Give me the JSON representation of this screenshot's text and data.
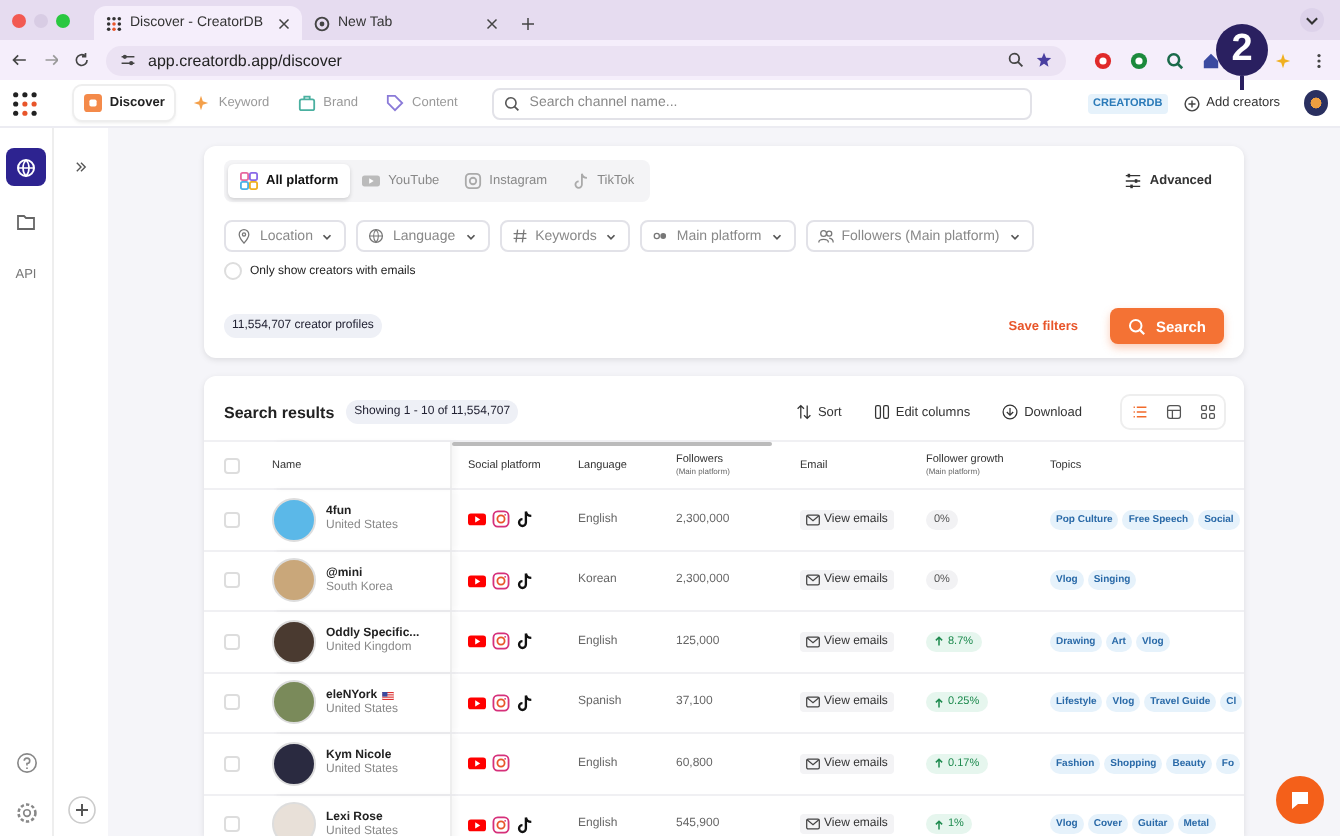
{
  "browser": {
    "tabs": [
      {
        "title": "Discover - CreatorDB",
        "selected": true
      },
      {
        "title": "New Tab",
        "selected": false
      }
    ],
    "url": "app.creatordb.app/discover",
    "annotation": "2"
  },
  "header": {
    "nav": [
      {
        "label": "Discover",
        "selected": true,
        "kind": "discover"
      },
      {
        "label": "Keyword",
        "selected": false,
        "kind": "keyword"
      },
      {
        "label": "Brand",
        "selected": false,
        "kind": "brand"
      },
      {
        "label": "Content",
        "selected": false,
        "kind": "content"
      }
    ],
    "search": {
      "placeholder": "Search channel name..."
    },
    "brand_badge": "CREATORDB",
    "add_button": "Add creators"
  },
  "rail": {
    "items": [
      {
        "kind": "globe",
        "selected": true
      },
      {
        "kind": "folder",
        "selected": false
      },
      {
        "kind": "text",
        "label": "API",
        "selected": false
      }
    ]
  },
  "filters": {
    "platforms": [
      {
        "label": "All platform",
        "selected": true,
        "kind": "all"
      },
      {
        "label": "YouTube",
        "selected": false,
        "kind": "youtube"
      },
      {
        "label": "Instagram",
        "selected": false,
        "kind": "instagram"
      },
      {
        "label": "TikTok",
        "selected": false,
        "kind": "tiktok"
      }
    ],
    "advanced": "Advanced",
    "dropdowns": [
      {
        "label": "Location",
        "kind": "pin"
      },
      {
        "label": "Language",
        "kind": "globe"
      },
      {
        "label": "Keywords",
        "kind": "hash"
      },
      {
        "label": "Main platform",
        "kind": "dots"
      },
      {
        "label": "Followers (Main platform)",
        "kind": "people"
      }
    ],
    "email_only": {
      "label": "Only show creators with emails",
      "checked": false
    },
    "count": "11,554,707 creator profiles",
    "save": "Save filters",
    "search": "Search"
  },
  "results": {
    "title": "Search results",
    "showing": "Showing 1 - 10 of 11,554,707",
    "actions": [
      {
        "label": "Sort",
        "kind": "sort"
      },
      {
        "label": "Edit columns",
        "kind": "columns"
      },
      {
        "label": "Download",
        "kind": "download"
      }
    ],
    "views": [
      {
        "kind": "list",
        "selected": true
      },
      {
        "kind": "table",
        "selected": false
      },
      {
        "kind": "grid",
        "selected": false
      }
    ],
    "select_all": {
      "checked": false
    },
    "columns": [
      {
        "label": "Name"
      },
      {
        "label": "Social platform"
      },
      {
        "label": "Language"
      },
      {
        "label": "Followers",
        "sub": "(Main platform)"
      },
      {
        "label": "Email"
      },
      {
        "label": "Follower growth",
        "sub": "(Main platform)"
      },
      {
        "label": "Topics"
      }
    ],
    "rows": [
      {
        "checked": false,
        "name": "4fun",
        "country": "United States",
        "platforms": [
          {
            "kind": "youtube"
          },
          {
            "kind": "instagram"
          },
          {
            "kind": "tiktok"
          }
        ],
        "language": "English",
        "followers": "2,300,000",
        "email": "View emails",
        "growth": {
          "text": "0%",
          "kind": "flat"
        },
        "topics": [
          "Pop Culture",
          "Free Speech",
          "Social"
        ]
      },
      {
        "checked": false,
        "name": "@mini",
        "country": "South Korea",
        "platforms": [
          {
            "kind": "youtube"
          },
          {
            "kind": "instagram"
          },
          {
            "kind": "tiktok"
          }
        ],
        "language": "Korean",
        "followers": "2,300,000",
        "email": "View emails",
        "growth": {
          "text": "0%",
          "kind": "flat"
        },
        "topics": [
          "Vlog",
          "Singing"
        ]
      },
      {
        "checked": false,
        "name": "Oddly Specific...",
        "country": "United Kingdom",
        "platforms": [
          {
            "kind": "youtube"
          },
          {
            "kind": "instagram"
          },
          {
            "kind": "tiktok"
          }
        ],
        "language": "English",
        "followers": "125,000",
        "email": "View emails",
        "growth": {
          "text": "8.7%",
          "kind": "up"
        },
        "topics": [
          "Drawing",
          "Art",
          "Vlog"
        ]
      },
      {
        "checked": false,
        "name": "eleNYork",
        "flag": true,
        "country": "United States",
        "platforms": [
          {
            "kind": "youtube"
          },
          {
            "kind": "instagram"
          },
          {
            "kind": "tiktok"
          }
        ],
        "language": "Spanish",
        "followers": "37,100",
        "email": "View emails",
        "growth": {
          "text": "0.25%",
          "kind": "up"
        },
        "topics": [
          "Lifestyle",
          "Vlog",
          "Travel Guide",
          "Cl"
        ]
      },
      {
        "checked": false,
        "name": "Kym Nicole",
        "country": "United States",
        "platforms": [
          {
            "kind": "youtube"
          },
          {
            "kind": "instagram"
          }
        ],
        "language": "English",
        "followers": "60,800",
        "email": "View emails",
        "growth": {
          "text": "0.17%",
          "kind": "up"
        },
        "topics": [
          "Fashion",
          "Shopping",
          "Beauty",
          "Fo"
        ]
      },
      {
        "checked": false,
        "name": "Lexi Rose",
        "country": "United States",
        "platforms": [
          {
            "kind": "youtube"
          },
          {
            "kind": "instagram"
          },
          {
            "kind": "tiktok"
          }
        ],
        "language": "English",
        "followers": "545,900",
        "email": "View emails",
        "growth": {
          "text": "1%",
          "kind": "up"
        },
        "topics": [
          "Vlog",
          "Cover",
          "Guitar",
          "Metal"
        ]
      }
    ]
  }
}
